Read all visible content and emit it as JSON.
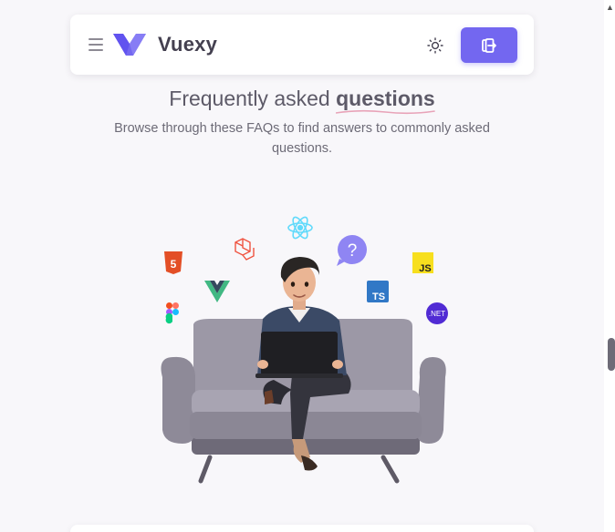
{
  "navbar": {
    "brand": "Vuexy",
    "menu_icon": "hamburger-menu-icon",
    "theme_icon": "sun-icon",
    "login_icon": "login-icon",
    "accent_color": "#7367f0"
  },
  "faq": {
    "title_prefix": "Frequently asked ",
    "title_highlight": "questions",
    "subtitle": "Browse through these FAQs to find answers to commonly asked questions."
  },
  "illustration": {
    "badges": {
      "ts": "TS",
      "js": "JS",
      "net": ".NET",
      "html": "5",
      "help": "?"
    }
  }
}
